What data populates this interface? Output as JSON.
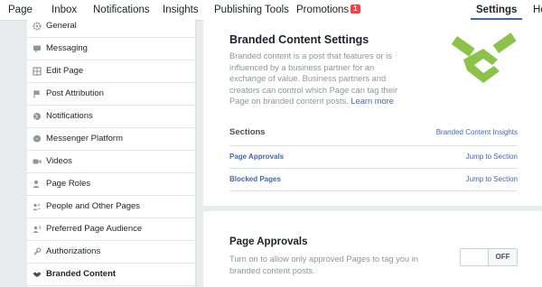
{
  "topnav": {
    "tabs": [
      {
        "label": "Page"
      },
      {
        "label": "Inbox"
      },
      {
        "label": "Notifications"
      },
      {
        "label": "Insights"
      },
      {
        "label": "Publishing Tools"
      },
      {
        "label": "Promotions",
        "badge": "1"
      },
      {
        "label": "Settings",
        "active": true
      },
      {
        "label": "He"
      }
    ]
  },
  "sidebar": {
    "items": [
      {
        "label": "General",
        "icon": "gear-icon"
      },
      {
        "label": "Messaging",
        "icon": "chat-icon"
      },
      {
        "label": "Edit Page",
        "icon": "grid-icon"
      },
      {
        "label": "Post Attribution",
        "icon": "flag-icon"
      },
      {
        "label": "Notifications",
        "icon": "globe-icon"
      },
      {
        "label": "Messenger Platform",
        "icon": "messenger-icon"
      },
      {
        "label": "Videos",
        "icon": "video-icon"
      },
      {
        "label": "Page Roles",
        "icon": "person-icon"
      },
      {
        "label": "People and Other Pages",
        "icon": "people-icon"
      },
      {
        "label": "Preferred Page Audience",
        "icon": "audience-icon"
      },
      {
        "label": "Authorizations",
        "icon": "wrench-icon"
      },
      {
        "label": "Branded Content",
        "icon": "handshake-icon",
        "active": true
      }
    ]
  },
  "branded": {
    "title": "Branded Content Settings",
    "description": "Branded content is a post that features or is influenced by a business partner for an exchange of value. Business partners and creators can control which Page can tag their Page on branded content posts.",
    "learn_more": "Learn more",
    "logo_color": "#8bc34a",
    "sections_label": "Sections",
    "sections_link": "Branded Content Insights",
    "rows": [
      {
        "name": "Page Approvals",
        "link": "Jump to Section"
      },
      {
        "name": "Blocked Pages",
        "link": "Jump to Section"
      }
    ]
  },
  "approvals": {
    "title": "Page Approvals",
    "description": "Turn on to allow only approved Pages to tag you in branded content posts.",
    "toggle_state": "OFF"
  },
  "colors": {
    "accent": "#4267b2",
    "badge": "#fa3e3e",
    "muted_text": "#90949c",
    "background": "#e9ebee"
  }
}
